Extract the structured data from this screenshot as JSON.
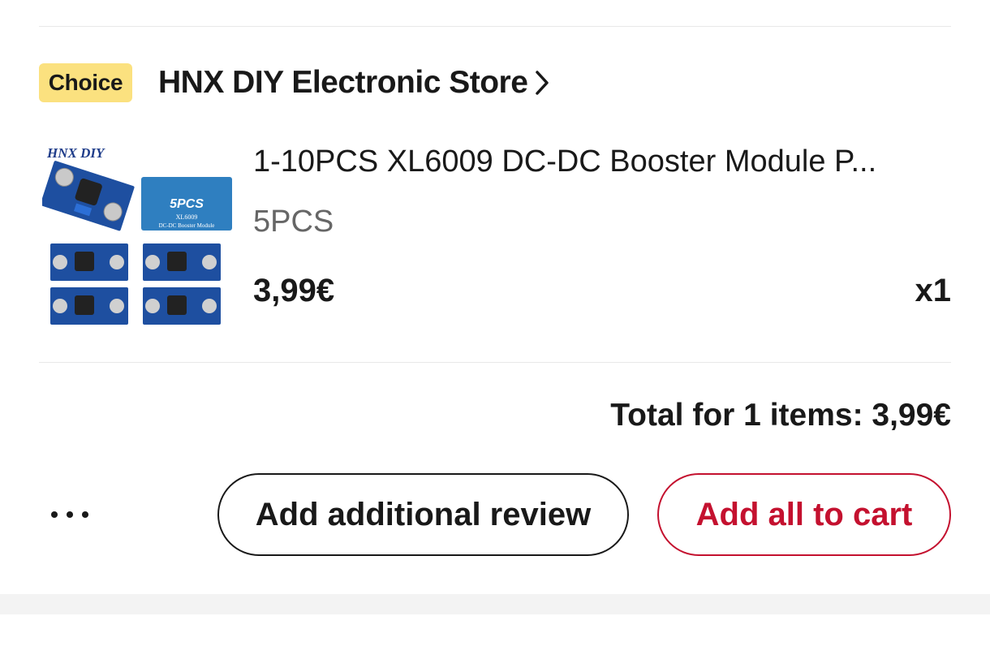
{
  "store": {
    "badge": "Choice",
    "name": "HNX DIY Electronic Store",
    "chevron_icon": "chevron-right-icon"
  },
  "product": {
    "image": {
      "brand_text": "HNX DIY",
      "box_count": "5PCS",
      "box_model": "XL6009",
      "box_desc": "DC-DC Booster Module",
      "box_color": "#2f7fc0"
    },
    "title": "1-10PCS XL6009 DC-DC Booster Module P...",
    "sku": "5PCS",
    "price": "3,99€",
    "quantity": "x1"
  },
  "summary": {
    "total_label": "Total for 1 items: 3,99€"
  },
  "actions": {
    "more_icon": "more-horizontal-icon",
    "review_label": "Add additional review",
    "cart_label": "Add all to cart"
  },
  "colors": {
    "badge_bg": "#fbe17f",
    "accent_red": "#c4112f",
    "text_primary": "#191919",
    "text_secondary": "#666666"
  }
}
